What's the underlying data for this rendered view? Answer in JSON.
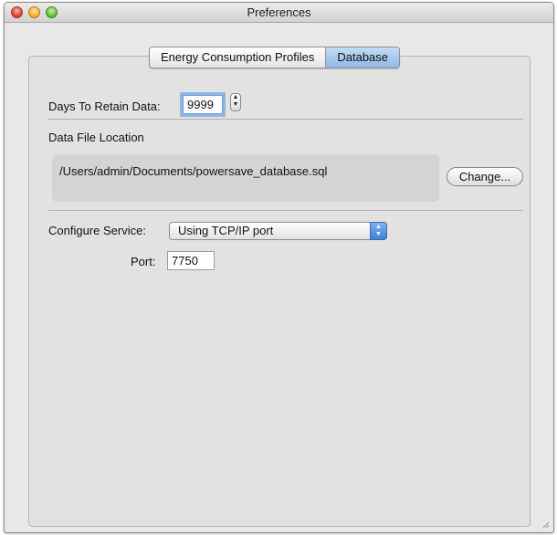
{
  "window": {
    "title": "Preferences"
  },
  "tabs": [
    {
      "label": "Energy Consumption Profiles",
      "active": false
    },
    {
      "label": "Database",
      "active": true
    }
  ],
  "retention": {
    "label": "Days To Retain Data:",
    "value": "9999"
  },
  "data_file": {
    "section_label": "Data File Location",
    "path": "/Users/admin/Documents/powersave_database.sql",
    "change_label": "Change..."
  },
  "service": {
    "label": "Configure Service:",
    "selected": "Using TCP/IP port"
  },
  "port": {
    "label": "Port:",
    "value": "7750"
  },
  "colors": {
    "accent": "#8fb7e6",
    "window_bg": "#e8e8e8"
  },
  "icons": [
    "close-button",
    "minimize-button",
    "zoom-button",
    "stepper-arrows-icon",
    "popup-arrows-icon",
    "resize-grip-icon"
  ]
}
